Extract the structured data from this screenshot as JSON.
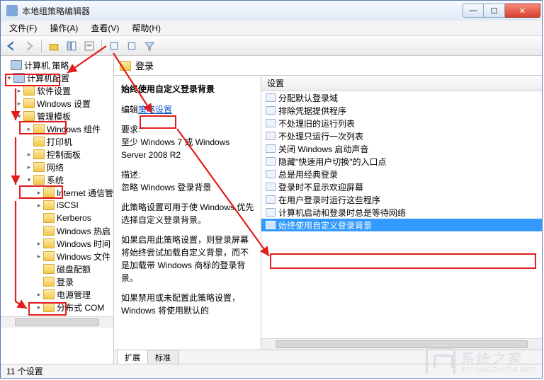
{
  "window": {
    "title": "本地组策略编辑器"
  },
  "menu": {
    "file": "文件(F)",
    "action": "操作(A)",
    "view": "查看(V)",
    "help": "帮助(H)"
  },
  "tree": {
    "root": "计算机 策略",
    "n1": "计算机配置",
    "n1a": "软件设置",
    "n1b": "Windows 设置",
    "n1c": "管理模板",
    "n1c1": "Windows 组件",
    "n1c2": "打印机",
    "n1c3": "控制面板",
    "n1c4": "网络",
    "n1c5": "系统",
    "n1c5a": "Internet 通信管",
    "n1c5b": "iSCSI",
    "n1c5c": "Kerberos",
    "n1c5d": "Windows 热启",
    "n1c5e": "Windows 时间",
    "n1c5f": "Windows 文件",
    "n1c5g": "磁盘配额",
    "n1c5h": "登录",
    "n1c5i": "电源管理",
    "n1c5j": "分布式 COM"
  },
  "header": {
    "path": "登录"
  },
  "desc": {
    "title": "始终使用自定义登录背景",
    "edit_label": "编辑",
    "edit_link": "策略设置",
    "req_label": "要求:",
    "req_text": "至少 Windows 7 或 Windows Server 2008 R2",
    "desc_label": "描述:",
    "desc_text1": "忽略 Windows 登录背景",
    "desc_text2": "此策略设置可用于使 Windows 优先选择自定义登录背景。",
    "desc_text3": "如果启用此策略设置，则登录屏幕将始终尝试加载自定义背景，而不是加载带 Windows 商标的登录背景。",
    "desc_text4": "如果禁用或未配置此策略设置，Windows 将使用默认的"
  },
  "list": {
    "header": "设置",
    "items": [
      "分配默认登录域",
      "排除凭据提供程序",
      "不处理旧的运行列表",
      "不处理只运行一次列表",
      "关闭 Windows 启动声音",
      "隐藏\"快速用户切换\"的入口点",
      "总是用经典登录",
      "登录时不显示欢迎屏幕",
      "在用户登录时运行这些程序",
      "计算机启动和登录时总是等待网络",
      "始终使用自定义登录背景"
    ],
    "selected_index": 10
  },
  "tabs": {
    "extended": "扩展",
    "standard": "标准"
  },
  "status": {
    "text": "11 个设置"
  },
  "watermark": {
    "line1": "系统之家",
    "line2": "XITONGZHIJIA.NET"
  }
}
